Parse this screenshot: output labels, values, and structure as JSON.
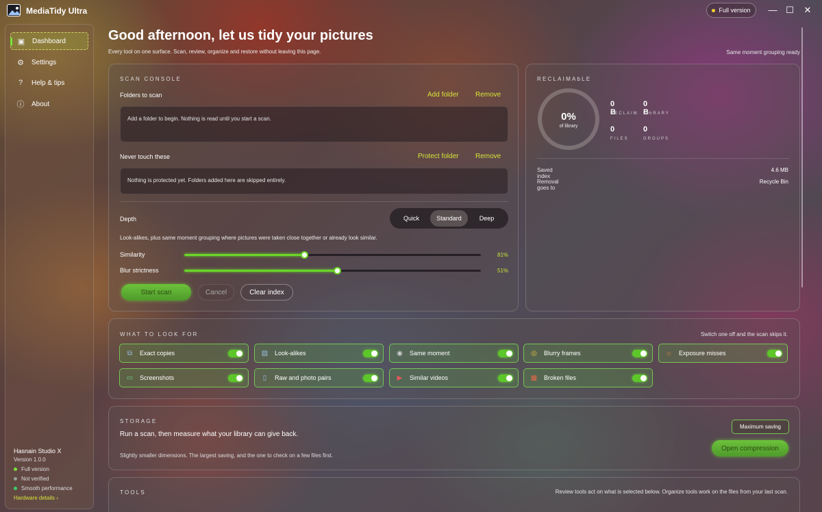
{
  "app": {
    "title": "MediaTidy Ultra",
    "full_version_label": "Full version"
  },
  "window_controls": {
    "minimize": "—",
    "maximize": "☐",
    "close": "✕"
  },
  "sidebar": {
    "items": [
      {
        "label": "Dashboard",
        "icon": "dashboard-icon",
        "glyph": "▣"
      },
      {
        "label": "Settings",
        "icon": "gear-icon",
        "glyph": "⚙"
      },
      {
        "label": "Help & tips",
        "icon": "question-icon",
        "glyph": "?"
      },
      {
        "label": "About",
        "icon": "info-icon",
        "glyph": "ⓘ"
      }
    ],
    "footer": {
      "studio": "Hasnain Studio X",
      "version": "Version 1.0.0",
      "statuses": [
        {
          "label": "Full version",
          "color": "#7ae23a"
        },
        {
          "label": "Not verified",
          "color": "#9aa09a"
        },
        {
          "label": "Smooth performance",
          "color": "#3ad06a"
        }
      ],
      "hardware_link": "Hardware details ›"
    }
  },
  "header": {
    "title": "Good afternoon, let us tidy your pictures",
    "subtitle": "Every tool on one surface. Scan, review, organize and restore without leaving this page.",
    "note": "Same moment grouping ready"
  },
  "scan_console": {
    "heading": "SCAN CONSOLE",
    "folders_label": "Folders to scan",
    "add_folder": "Add folder",
    "remove": "Remove",
    "folders_empty": "Add a folder to begin. Nothing is read until you start a scan.",
    "never_touch_label": "Never touch these",
    "protect_folder": "Protect folder",
    "protected_empty": "Nothing is protected yet. Folders added here are skipped entirely.",
    "depth_label": "Depth",
    "depth_options": [
      "Quick",
      "Standard",
      "Deep"
    ],
    "depth_selected": "Standard",
    "depth_description": "Look-alikes, plus same moment grouping where pictures were taken close together or already look similar.",
    "similarity_label": "Similarity",
    "similarity_value": 81,
    "similarity_text": "81%",
    "blur_label": "Blur strictness",
    "blur_value": 51,
    "blur_text": "51%",
    "start_scan": "Start scan",
    "cancel": "Cancel",
    "clear_index": "Clear index"
  },
  "reclaimable": {
    "heading": "RECLAIMAbLE",
    "percent": "0%",
    "percent_label": "of library",
    "stats": [
      {
        "value": "0 B",
        "label": "RECLAIM"
      },
      {
        "value": "0 B",
        "label": "LIbRARY"
      },
      {
        "value": "0",
        "label": "FILES"
      },
      {
        "value": "0",
        "label": "GROUPS"
      }
    ],
    "saved_index_label": "Saved index",
    "saved_index_value": "4.6 MB",
    "removal_label": "Removal goes to",
    "removal_value": "Recycle Bin"
  },
  "look_for": {
    "heading": "WHAT TO LOOK FOR",
    "note": "Switch one off and the scan skips it.",
    "items": [
      {
        "label": "Exact copies",
        "icon": "copy-icon",
        "glyph": "⧉",
        "on": true
      },
      {
        "label": "Look-alikes",
        "icon": "image-icon",
        "glyph": "▨",
        "on": true
      },
      {
        "label": "Same moment",
        "icon": "camera-icon",
        "glyph": "◉",
        "on": true
      },
      {
        "label": "Blurry frames",
        "icon": "eye-icon",
        "glyph": "◎",
        "on": true
      },
      {
        "label": "Exposure misses",
        "icon": "sun-icon",
        "glyph": "☼",
        "on": true
      },
      {
        "label": "Screenshots",
        "icon": "screenshot-icon",
        "glyph": "▭",
        "on": true
      },
      {
        "label": "Raw and photo pairs",
        "icon": "file-icon",
        "glyph": "▯",
        "on": true
      },
      {
        "label": "Similar videos",
        "icon": "video-icon",
        "glyph": "▶",
        "on": true
      },
      {
        "label": "Broken files",
        "icon": "broken-file-icon",
        "glyph": "▦",
        "on": true
      }
    ]
  },
  "storage": {
    "heading": "STORAGE",
    "message": "Run a scan, then measure what your library can give back.",
    "detail": "Slightly smaller dimensions. The largest saving, and the one to check on a few files first.",
    "badge": "Maximum saving",
    "button": "Open compression"
  },
  "tools": {
    "heading": "TOOLS",
    "note": "Review tools act on what is selected below. Organize tools work on the files from your last scan."
  }
}
